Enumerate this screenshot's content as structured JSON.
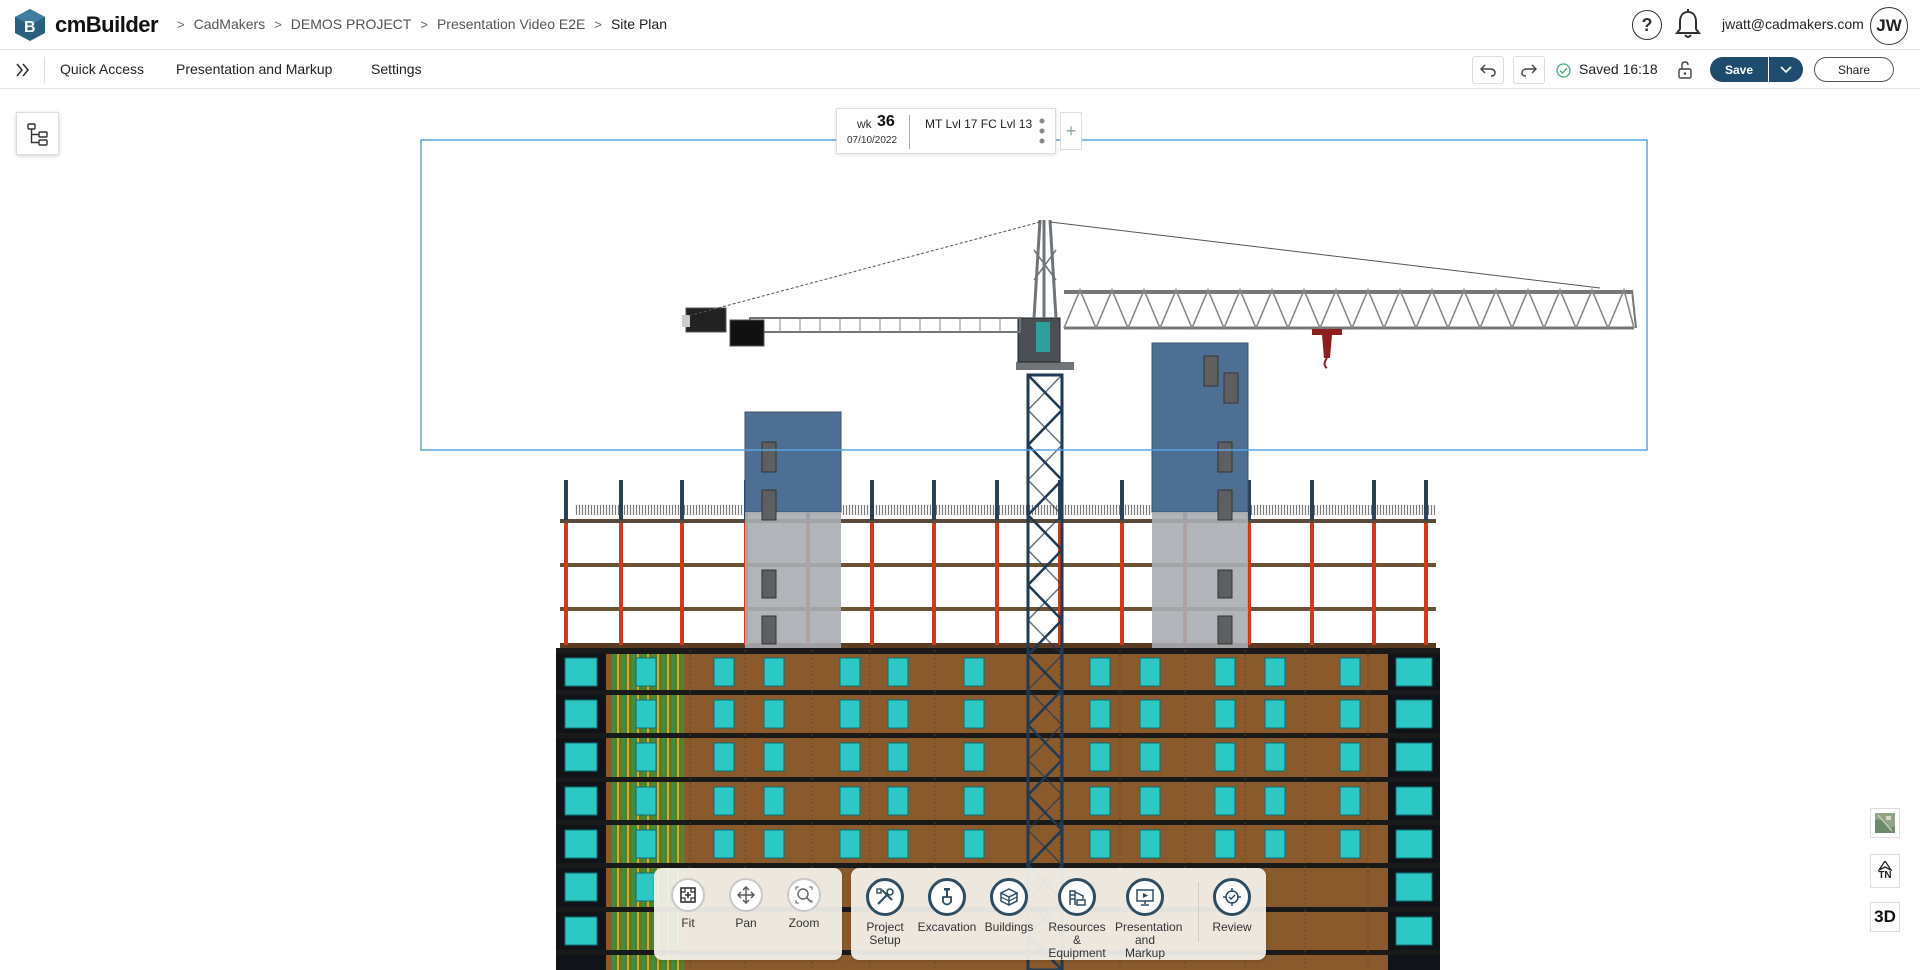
{
  "app": {
    "brand": "cmBuilder"
  },
  "breadcrumb": {
    "items": [
      "CadMakers",
      "DEMOS PROJECT",
      "Presentation Video E2E",
      "Site Plan"
    ]
  },
  "header": {
    "user_email": "jwatt@cadmakers.com",
    "avatar_initials": "JW",
    "help_label": "?"
  },
  "menu": {
    "items": [
      "Quick Access",
      "Presentation and Markup",
      "Settings"
    ]
  },
  "status": {
    "saved_text": "Saved 16:18"
  },
  "actions": {
    "save_label": "Save",
    "share_label": "Share"
  },
  "timeline": {
    "week_label": "wk",
    "week_number": "36",
    "date": "07/10/2022",
    "phase": "MT Lvl 17 FC Lvl 13",
    "add_label": "+"
  },
  "view_tools": [
    {
      "label": "Fit",
      "icon": "fit-icon"
    },
    {
      "label": "Pan",
      "icon": "pan-icon"
    },
    {
      "label": "Zoom",
      "icon": "zoom-icon"
    }
  ],
  "main_tools": [
    {
      "label": "Project Setup",
      "line1": "Project",
      "line2": "Setup",
      "icon": "tools-icon"
    },
    {
      "label": "Excavation",
      "line1": "Excavation",
      "line2": "",
      "icon": "shovel-icon"
    },
    {
      "label": "Buildings",
      "line1": "Buildings",
      "line2": "",
      "icon": "building-icon"
    },
    {
      "label": "Resources & Equipment",
      "line1": "Resources &",
      "line2": "Equipment",
      "icon": "equipment-icon"
    },
    {
      "label": "Presentation and Markup",
      "line1": "Presentation",
      "line2": "and Markup",
      "icon": "presentation-icon"
    },
    {
      "label": "Review",
      "line1": "Review",
      "line2": "",
      "icon": "review-icon"
    }
  ],
  "side_controls": {
    "north_label": "TN",
    "view_mode": "3D"
  },
  "colors": {
    "primary": "#1e4c6e",
    "selection": "#5aa5e0",
    "glass": "#2ec8c4",
    "cladding": "#8a5a2c",
    "core": "#4e6f94",
    "crane": "#1e3a54",
    "column_red": "#d23a1a"
  }
}
